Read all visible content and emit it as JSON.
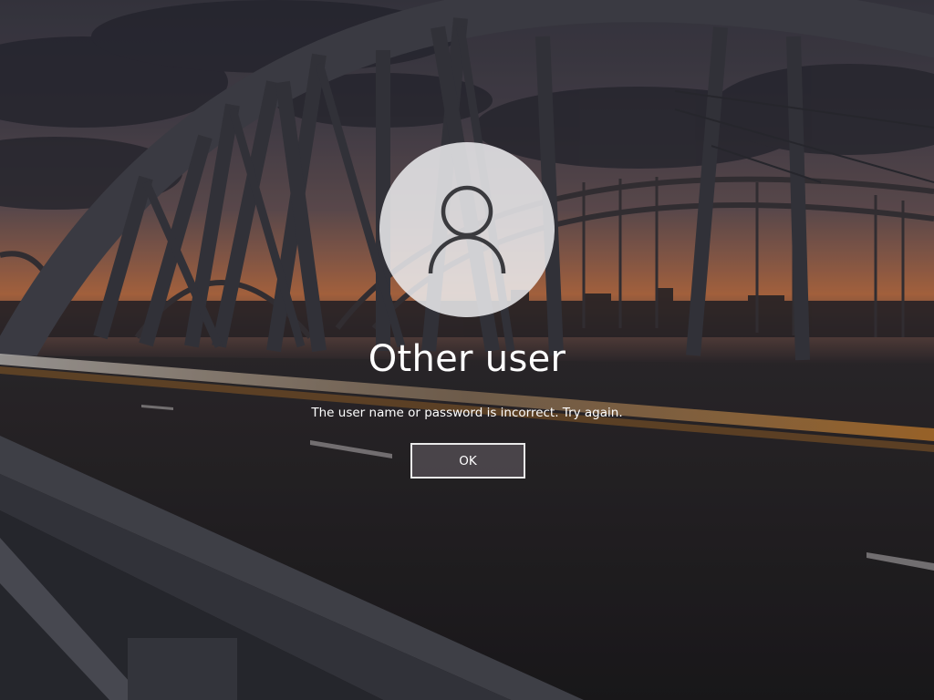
{
  "lock_screen": {
    "avatar_icon": "user-silhouette-icon",
    "user_name": "Other user",
    "error_message": "The user name or password is incorrect. Try again.",
    "ok_button_label": "OK"
  },
  "colors": {
    "text": "#ffffff",
    "avatar_background": "#ebebee",
    "avatar_icon": "#3a3a3e",
    "button_border": "#eaeaea",
    "button_background": "#504a50"
  }
}
